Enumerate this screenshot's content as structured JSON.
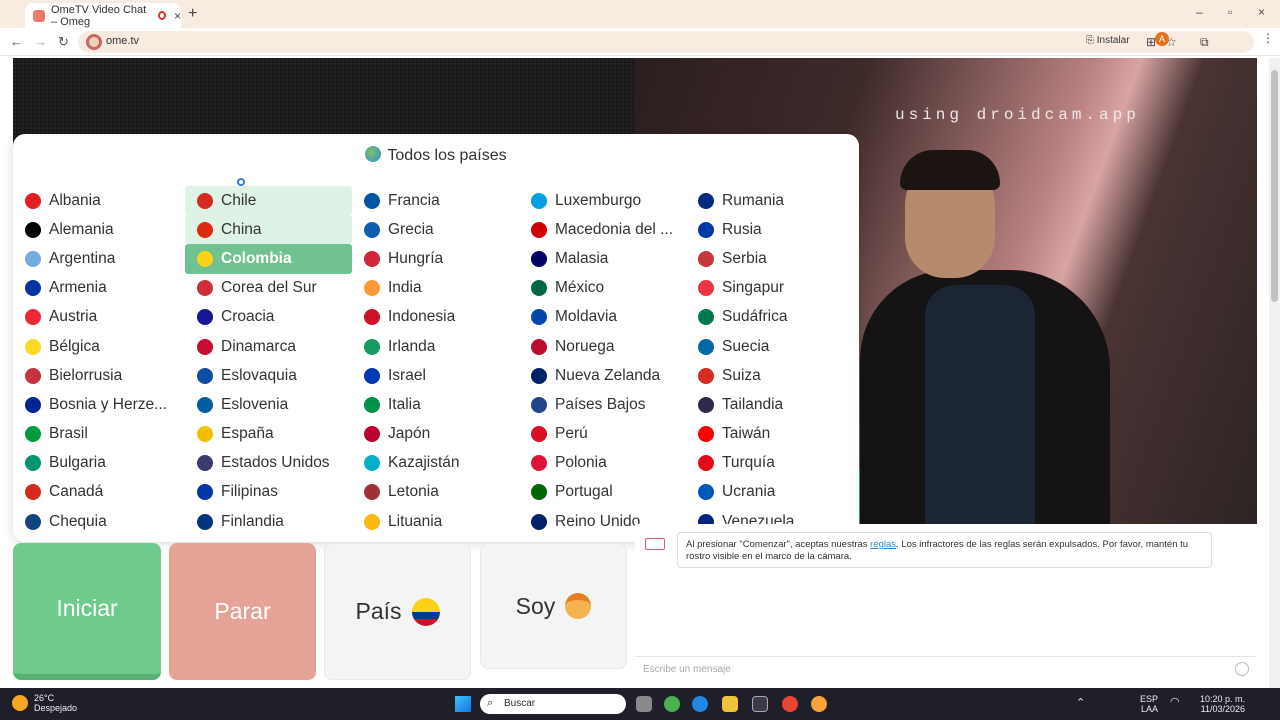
{
  "browser": {
    "tab_title": "OmeTV Video Chat – Omeg",
    "tab_close": "×",
    "new_tab": "+",
    "win_controls": [
      "–",
      "▫",
      "×"
    ],
    "url": "ome.tv",
    "install_label": "Instalar",
    "profile_initial": "A"
  },
  "video": {
    "watermark": "using droidcam.app"
  },
  "country_panel": {
    "header": "Todos los países",
    "selected": "Colombia",
    "hovered": [
      "Chile",
      "China"
    ],
    "columns": [
      [
        {
          "name": "Albania",
          "flag": "#e41e20"
        },
        {
          "name": "Alemania",
          "flag": "#000000"
        },
        {
          "name": "Argentina",
          "flag": "#74acdf"
        },
        {
          "name": "Armenia",
          "flag": "#0033a0"
        },
        {
          "name": "Austria",
          "flag": "#ed2939"
        },
        {
          "name": "Bélgica",
          "flag": "#fdda24"
        },
        {
          "name": "Bielorrusia",
          "flag": "#c8313e"
        },
        {
          "name": "Bosnia y Herze...",
          "flag": "#002395"
        },
        {
          "name": "Brasil",
          "flag": "#009c3b"
        },
        {
          "name": "Bulgaria",
          "flag": "#00966e"
        },
        {
          "name": "Canadá",
          "flag": "#d52b1e"
        },
        {
          "name": "Chequia",
          "flag": "#11457e"
        }
      ],
      [
        {
          "name": "Chile",
          "flag": "#d52b1e"
        },
        {
          "name": "China",
          "flag": "#de2910"
        },
        {
          "name": "Colombia",
          "flag": "#fcd116"
        },
        {
          "name": "Corea del Sur",
          "flag": "#cd2e3a"
        },
        {
          "name": "Croacia",
          "flag": "#171796"
        },
        {
          "name": "Dinamarca",
          "flag": "#c60c30"
        },
        {
          "name": "Eslovaquia",
          "flag": "#0b4ea2"
        },
        {
          "name": "Eslovenia",
          "flag": "#005da4"
        },
        {
          "name": "España",
          "flag": "#f1bf00"
        },
        {
          "name": "Estados Unidos",
          "flag": "#3c3b6e"
        },
        {
          "name": "Filipinas",
          "flag": "#0038a8"
        },
        {
          "name": "Finlandia",
          "flag": "#003580"
        }
      ],
      [
        {
          "name": "Francia",
          "flag": "#0055a4"
        },
        {
          "name": "Grecia",
          "flag": "#0d5eaf"
        },
        {
          "name": "Hungría",
          "flag": "#ce2939"
        },
        {
          "name": "India",
          "flag": "#ff9933"
        },
        {
          "name": "Indonesia",
          "flag": "#ce1126"
        },
        {
          "name": "Irlanda",
          "flag": "#169b62"
        },
        {
          "name": "Israel",
          "flag": "#0038b8"
        },
        {
          "name": "Italia",
          "flag": "#009246"
        },
        {
          "name": "Japón",
          "flag": "#bc002d"
        },
        {
          "name": "Kazajistán",
          "flag": "#00afca"
        },
        {
          "name": "Letonia",
          "flag": "#9e3039"
        },
        {
          "name": "Lituania",
          "flag": "#fdb913"
        }
      ],
      [
        {
          "name": "Luxemburgo",
          "flag": "#00a1de"
        },
        {
          "name": "Macedonia del ...",
          "flag": "#d20000"
        },
        {
          "name": "Malasia",
          "flag": "#010066"
        },
        {
          "name": "México",
          "flag": "#006847"
        },
        {
          "name": "Moldavia",
          "flag": "#0046ae"
        },
        {
          "name": "Noruega",
          "flag": "#ba0c2f"
        },
        {
          "name": "Nueva Zelanda",
          "flag": "#012169"
        },
        {
          "name": "Países Bajos",
          "flag": "#21468b"
        },
        {
          "name": "Perú",
          "flag": "#d91023"
        },
        {
          "name": "Polonia",
          "flag": "#dc143c"
        },
        {
          "name": "Portugal",
          "flag": "#006600"
        },
        {
          "name": "Reino Unido",
          "flag": "#012169"
        }
      ],
      [
        {
          "name": "Rumania",
          "flag": "#002b7f"
        },
        {
          "name": "Rusia",
          "flag": "#0039a6"
        },
        {
          "name": "Serbia",
          "flag": "#c6363c"
        },
        {
          "name": "Singapur",
          "flag": "#ef3340"
        },
        {
          "name": "Sudáfrica",
          "flag": "#007a4d"
        },
        {
          "name": "Suecia",
          "flag": "#006aa7"
        },
        {
          "name": "Suiza",
          "flag": "#d52b1e"
        },
        {
          "name": "Tailandia",
          "flag": "#2d2a4a"
        },
        {
          "name": "Taiwán",
          "flag": "#fe0000"
        },
        {
          "name": "Turquía",
          "flag": "#e30a17"
        },
        {
          "name": "Ucrania",
          "flag": "#0057b7"
        },
        {
          "name": "Venezuela",
          "flag": "#00247d"
        }
      ]
    ]
  },
  "controls": {
    "start": "Iniciar",
    "stop": "Parar",
    "country": "País",
    "gender": "Soy"
  },
  "chat": {
    "notice_before": "Al presionar \"Comenzar\", aceptas nuestras ",
    "notice_link": "reglas",
    "notice_after": ". Los infractores de las reglas serán expulsados. Por favor, mantén tu rostro visible en el marco de la cámara.",
    "placeholder": "Escribe un mensaje"
  },
  "taskbar": {
    "temperature": "26°C",
    "weather": "Despejado",
    "search": "Buscar",
    "lang1": "ESP",
    "lang2": "LAA",
    "time": "10:20 p. m.",
    "date": "11/03/2026"
  }
}
